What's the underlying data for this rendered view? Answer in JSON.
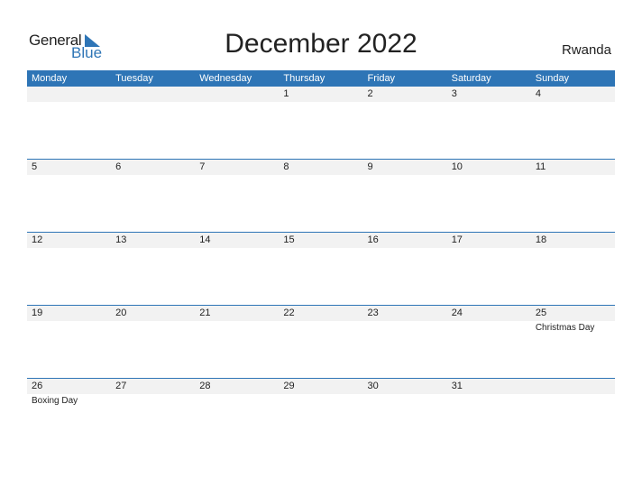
{
  "logo": {
    "general": "General",
    "blue": "Blue"
  },
  "title": "December 2022",
  "country": "Rwanda",
  "accent_color": "#2e75b6",
  "weekdays": [
    "Monday",
    "Tuesday",
    "Wednesday",
    "Thursday",
    "Friday",
    "Saturday",
    "Sunday"
  ],
  "weeks": [
    [
      {
        "day": ""
      },
      {
        "day": ""
      },
      {
        "day": ""
      },
      {
        "day": "1"
      },
      {
        "day": "2"
      },
      {
        "day": "3"
      },
      {
        "day": "4"
      }
    ],
    [
      {
        "day": "5"
      },
      {
        "day": "6"
      },
      {
        "day": "7"
      },
      {
        "day": "8"
      },
      {
        "day": "9"
      },
      {
        "day": "10"
      },
      {
        "day": "11"
      }
    ],
    [
      {
        "day": "12"
      },
      {
        "day": "13"
      },
      {
        "day": "14"
      },
      {
        "day": "15"
      },
      {
        "day": "16"
      },
      {
        "day": "17"
      },
      {
        "day": "18"
      }
    ],
    [
      {
        "day": "19"
      },
      {
        "day": "20"
      },
      {
        "day": "21"
      },
      {
        "day": "22"
      },
      {
        "day": "23"
      },
      {
        "day": "24"
      },
      {
        "day": "25",
        "holiday": "Christmas Day"
      }
    ],
    [
      {
        "day": "26",
        "holiday": "Boxing Day"
      },
      {
        "day": "27"
      },
      {
        "day": "28"
      },
      {
        "day": "29"
      },
      {
        "day": "30"
      },
      {
        "day": "31"
      },
      {
        "day": ""
      }
    ]
  ]
}
